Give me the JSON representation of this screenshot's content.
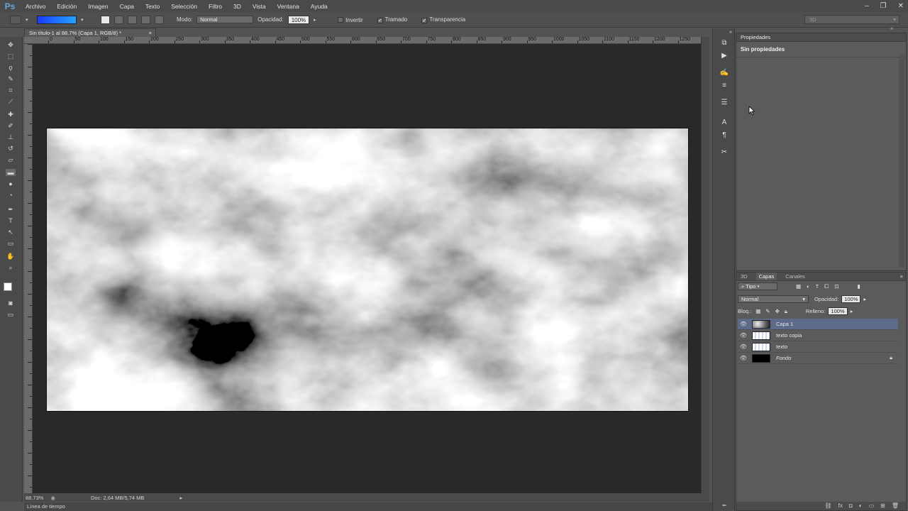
{
  "app": {
    "logo": "Ps"
  },
  "menu": [
    "Archivo",
    "Edición",
    "Imagen",
    "Capa",
    "Texto",
    "Selección",
    "Filtro",
    "3D",
    "Vista",
    "Ventana",
    "Ayuda"
  ],
  "window_controls": {
    "minimize": "–",
    "restore": "❐",
    "close": "✕"
  },
  "options_bar": {
    "mode_label": "Modo:",
    "mode_value": "Normal",
    "opacity_label": "Opacidad:",
    "opacity_value": "100%",
    "invert_label": "Invertir",
    "dither_label": "Tramado",
    "transparency_label": "Transparencia",
    "invert_checked": false,
    "dither_checked": true,
    "transparency_checked": true
  },
  "workspace": {
    "value": "3D"
  },
  "document": {
    "tab_title": "Sin título-1 al 88.7% (Capa 1, RGB/8) *",
    "ruler_marks": [
      "0",
      "50",
      "100",
      "150",
      "200",
      "250",
      "300",
      "350",
      "400",
      "450",
      "500",
      "550",
      "600",
      "650",
      "700",
      "750",
      "800",
      "850",
      "900",
      "950",
      "1000",
      "1050",
      "1100",
      "1150",
      "1200",
      "1250"
    ],
    "zoom": "88.73%",
    "doc_size": "Doc: 2,64 MB/5,74 MB"
  },
  "timeline": {
    "label": "Línea de tiempo"
  },
  "properties": {
    "tab": "Propiedades",
    "title": "Sin propiedades"
  },
  "layers_panel": {
    "tabs": [
      "3D",
      "Capas",
      "Canales"
    ],
    "active_tab": "Capas",
    "filter_label": "Tipo",
    "blend_mode": "Normal",
    "opacity_label": "Opacidad:",
    "opacity_value": "100%",
    "lock_label": "Bloq.:",
    "fill_label": "Relleno:",
    "fill_value": "100%",
    "layers": [
      {
        "name": "Capa 1",
        "selected": true,
        "italic": false,
        "thumb": "clouds"
      },
      {
        "name": "texto copia",
        "selected": false,
        "italic": false,
        "thumb": "text"
      },
      {
        "name": "texto",
        "selected": false,
        "italic": false,
        "thumb": "text"
      },
      {
        "name": "Fondo",
        "selected": false,
        "italic": true,
        "thumb": "black",
        "locked": true
      }
    ]
  },
  "colors": {
    "selected_layer": "#5d6a8a",
    "canvas_bg": "#2b2828",
    "gradient_start": "#1a3cff",
    "gradient_end": "#25a4ff",
    "foreground": "#ffffff",
    "background": "#000000"
  }
}
